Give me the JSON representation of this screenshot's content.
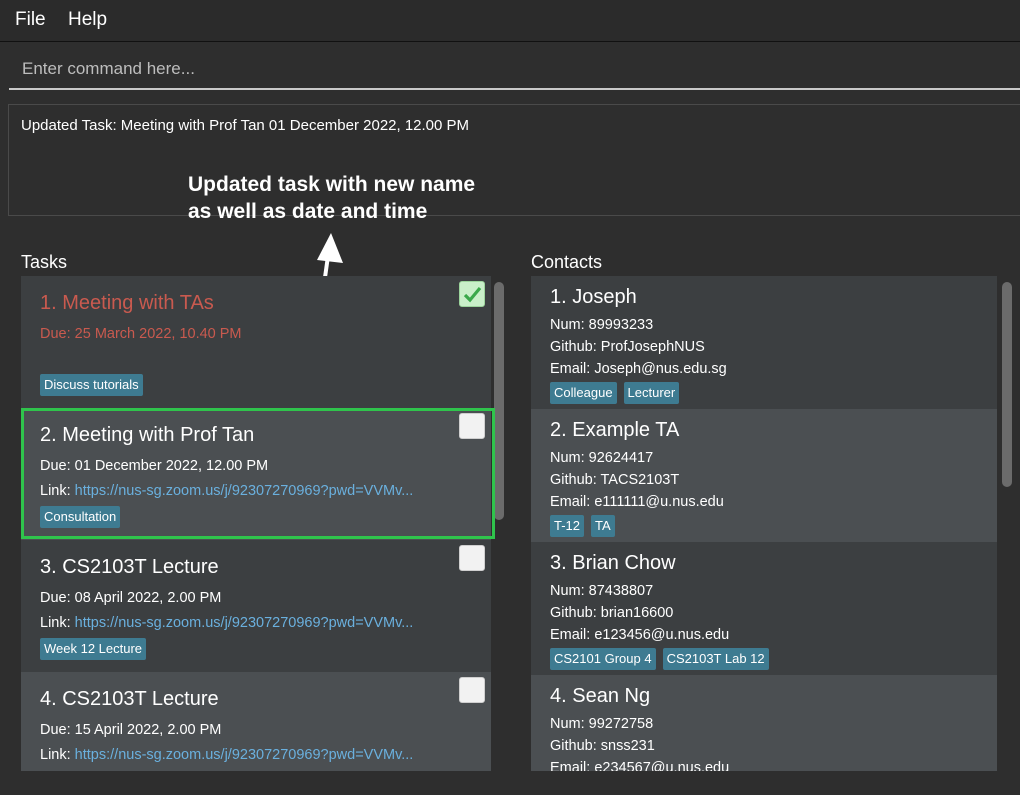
{
  "menu": {
    "file": "File",
    "help": "Help"
  },
  "command": {
    "placeholder": "Enter command here...",
    "value": ""
  },
  "result": {
    "text": "Updated Task: Meeting with Prof Tan 01 December 2022, 12.00 PM"
  },
  "annotation": {
    "line1": "Updated task with new name",
    "line2": "as well as date and time"
  },
  "tasks": {
    "title": "Tasks",
    "items": [
      {
        "title": "1.  Meeting with TAs",
        "due": "Due: 25 March 2022, 10.40 PM",
        "link_label": "",
        "link": "",
        "tags": [
          "Discuss tutorials"
        ],
        "done": true,
        "overdue": true
      },
      {
        "title": "2.  Meeting with Prof Tan",
        "due": "Due: 01 December 2022, 12.00 PM",
        "link_label": "Link: ",
        "link": "https://nus-sg.zoom.us/j/92307270969?pwd=VVMv...",
        "tags": [
          "Consultation"
        ],
        "done": false,
        "overdue": false
      },
      {
        "title": "3.  CS2103T Lecture",
        "due": "Due: 08 April 2022, 2.00 PM",
        "link_label": "Link: ",
        "link": "https://nus-sg.zoom.us/j/92307270969?pwd=VVMv...",
        "tags": [
          "Week 12 Lecture"
        ],
        "done": false,
        "overdue": false
      },
      {
        "title": "4.  CS2103T Lecture",
        "due": "Due: 15 April 2022, 2.00 PM",
        "link_label": "Link: ",
        "link": "https://nus-sg.zoom.us/j/92307270969?pwd=VVMv...",
        "tags": [],
        "done": false,
        "overdue": false
      }
    ]
  },
  "contacts": {
    "title": "Contacts",
    "items": [
      {
        "title": "1.  Joseph",
        "num": "Num: 89993233",
        "github": "Github: ProfJosephNUS",
        "email": "Email: Joseph@nus.edu.sg",
        "tags": [
          "Colleague",
          "Lecturer"
        ]
      },
      {
        "title": "2.  Example TA",
        "num": "Num: 92624417",
        "github": "Github: TACS2103T",
        "email": "Email: e111111@u.nus.edu",
        "tags": [
          "T-12",
          "TA"
        ]
      },
      {
        "title": "3.  Brian Chow",
        "num": "Num: 87438807",
        "github": "Github: brian16600",
        "email": "Email: e123456@u.nus.edu",
        "tags": [
          "CS2101 Group 4",
          "CS2103T Lab 12"
        ]
      },
      {
        "title": "4.  Sean Ng",
        "num": "Num: 99272758",
        "github": "Github: snss231",
        "email": "Email: e234567@u.nus.edu",
        "tags": []
      }
    ]
  },
  "colors": {
    "accent_highlight": "#2fc44c",
    "tag_bg": "#3e7b91",
    "link": "#6ab0de",
    "overdue": "#c95a4f"
  }
}
